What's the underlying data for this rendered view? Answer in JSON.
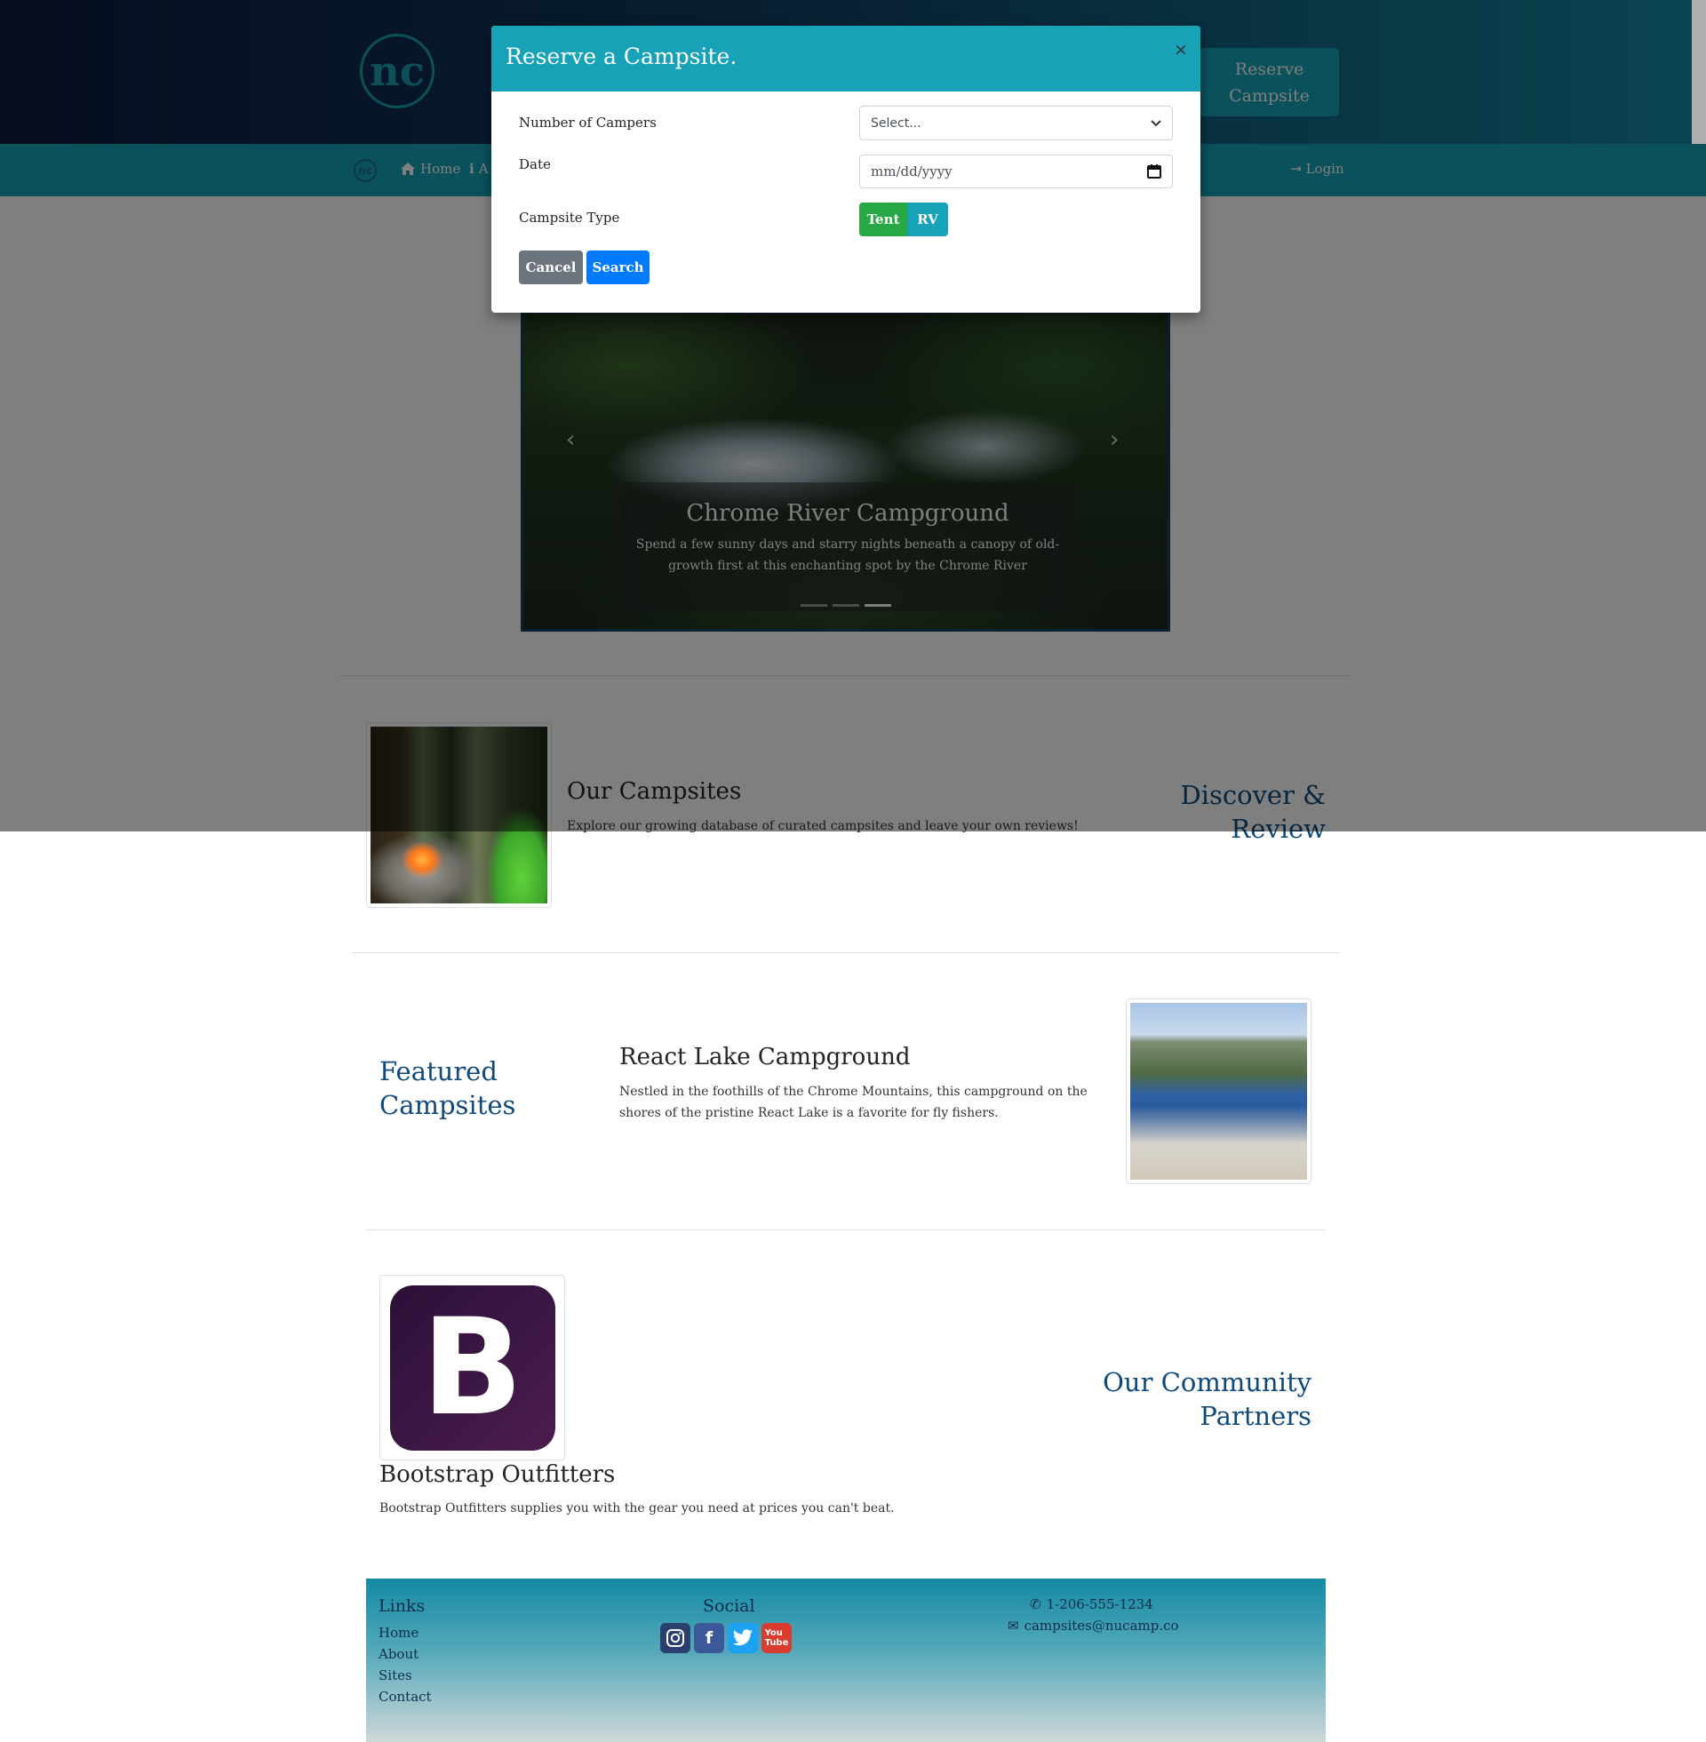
{
  "header": {
    "logo_text": "nc",
    "reserve_button": "Reserve Campsite"
  },
  "nav": {
    "logo_text": "nc",
    "home": "Home",
    "about": "A",
    "login": "Login"
  },
  "carousel": {
    "title": "Chrome River Campground",
    "text": "Spend a few sunny days and starry nights beneath a canopy of old-growth first at this enchanting spot by the Chrome River",
    "prev": "‹",
    "next": "›"
  },
  "sections": {
    "discover": {
      "heading": "Discover & Review",
      "title": "Our Campsites",
      "text": "Explore our growing database of curated campsites and leave your own reviews!"
    },
    "featured": {
      "heading": "Featured Campsites",
      "title": "React Lake Campground",
      "text": "Nestled in the foothills of the Chrome Mountains, this campground on the shores of the pristine React Lake is a favorite for fly fishers."
    },
    "partners": {
      "heading": "Our Community Partners",
      "logo_letter": "B",
      "title": "Bootstrap Outfitters",
      "text": "Bootstrap Outfitters supplies you with the gear you need at prices you can't beat."
    }
  },
  "footer": {
    "links_title": "Links",
    "links": [
      "Home",
      "About",
      "Sites",
      "Contact"
    ],
    "social_title": "Social",
    "social_icons": [
      "instagram-icon",
      "facebook-icon",
      "twitter-icon",
      "youtube-icon"
    ],
    "phone": "1-206-555-1234",
    "email": "campsites@nucamp.co"
  },
  "modal": {
    "title": "Reserve a Campsite.",
    "close": "×",
    "campers_label": "Number of Campers",
    "campers_value": "Select...",
    "date_label": "Date",
    "date_placeholder": "mm/dd/yyyy",
    "type_label": "Campsite Type",
    "tent": "Tent",
    "rv": "RV",
    "cancel": "Cancel",
    "search": "Search"
  },
  "colors": {
    "accent": "#17a2b8",
    "brand_dark": "#0f4a7b",
    "success": "#28a745",
    "primary": "#007bff",
    "secondary": "#6c757d"
  }
}
